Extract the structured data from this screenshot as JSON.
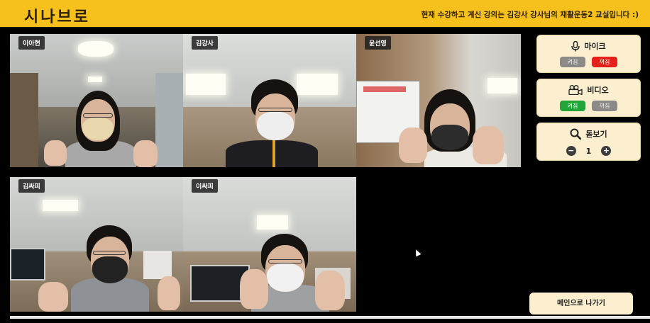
{
  "header": {
    "logo": "시나브로",
    "notice": "현재 수강하고 계신 강의는 김강사 강사님의 재활운동2 교실입니다 :)"
  },
  "participants": [
    {
      "name": "이아현"
    },
    {
      "name": "김강사"
    },
    {
      "name": "윤선영"
    },
    {
      "name": "김싸피"
    },
    {
      "name": "이싸피"
    }
  ],
  "controls": {
    "mic": {
      "label": "마이크",
      "on_label": "켜짐",
      "off_label": "꺼짐",
      "state": "off"
    },
    "video": {
      "label": "비디오",
      "on_label": "켜짐",
      "off_label": "꺼짐",
      "state": "on"
    },
    "zoom": {
      "label": "돋보기",
      "value": "1",
      "minus": "−",
      "plus": "+"
    }
  },
  "exit_button": {
    "label": "메인으로 나가기"
  },
  "colors": {
    "header_bg": "#f7c11d",
    "panel_bg": "#fbefd0",
    "active_green": "#23a53a",
    "active_red": "#e6201b",
    "inactive_gray": "#8c8a86"
  },
  "icons": {
    "mic": "microphone-icon",
    "video": "video-camera-icon",
    "zoom": "magnifier-icon"
  }
}
